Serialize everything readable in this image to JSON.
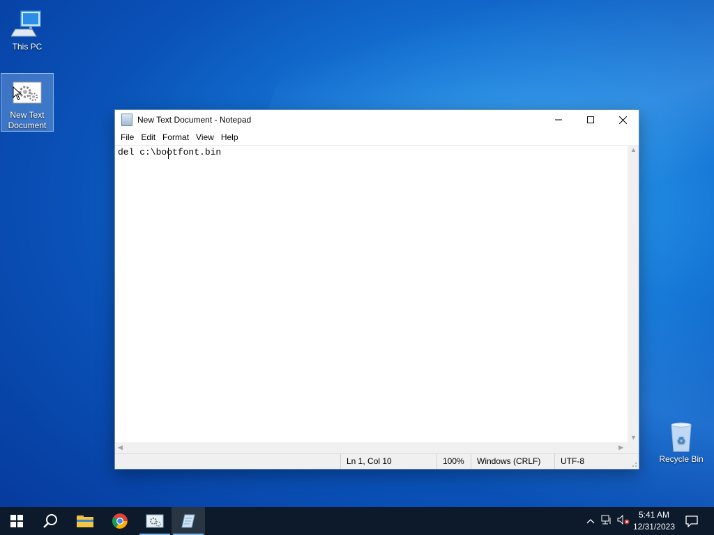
{
  "desktop": {
    "icons": [
      {
        "label": "This PC"
      },
      {
        "label": "New Text Document"
      },
      {
        "label": "Recycle Bin"
      }
    ]
  },
  "notepad": {
    "title": "New Text Document - Notepad",
    "menu": [
      "File",
      "Edit",
      "Format",
      "View",
      "Help"
    ],
    "content": "del c:\\bootfont.bin",
    "status": {
      "position": "Ln 1, Col 10",
      "zoom": "100%",
      "line_ending": "Windows (CRLF)",
      "encoding": "UTF-8"
    }
  },
  "taskbar": {
    "apps": [
      "start-icon",
      "search-icon",
      "file-explorer-icon",
      "chrome-icon",
      "settings-app-icon",
      "notepad-icon"
    ],
    "active_app": "notepad-icon",
    "time": "5:41 AM",
    "date": "12/31/2023"
  },
  "colors": {
    "taskbar": "#0d1a2b",
    "accent": "#76b9ed",
    "desktop": "#1677d6"
  }
}
